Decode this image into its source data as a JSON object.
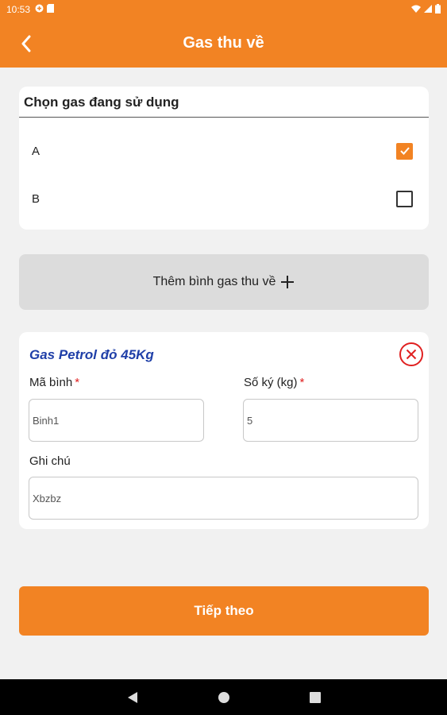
{
  "status_bar": {
    "time": "10:53",
    "icons_left": [
      "status-app-icon",
      "sd-card-icon"
    ],
    "icons_right": [
      "wifi-icon",
      "signal-icon",
      "battery-icon"
    ]
  },
  "app_bar": {
    "title": "Gas thu về",
    "back_icon": "chevron-left-icon"
  },
  "choose_gas": {
    "title": "Chọn gas đang sử dụng",
    "options": [
      {
        "label": "A",
        "checked": true
      },
      {
        "label": "B",
        "checked": false
      }
    ]
  },
  "add_button": {
    "label": "Thêm bình gas thu về",
    "icon": "plus-icon"
  },
  "gas_item": {
    "name": "Gas Petrol đỏ 45Kg",
    "remove_icon": "close-circle-icon",
    "code_label": "Mã bình",
    "code_value": "Binh1",
    "weight_label": "Số ký (kg)",
    "weight_value": "5",
    "required_mark": "*",
    "note_label": "Ghi chú",
    "note_value": "Xbzbz"
  },
  "next_button": {
    "label": "Tiếp theo"
  },
  "colors": {
    "accent": "#f28323",
    "item_title": "#1f3fa8",
    "required": "#e02020"
  }
}
